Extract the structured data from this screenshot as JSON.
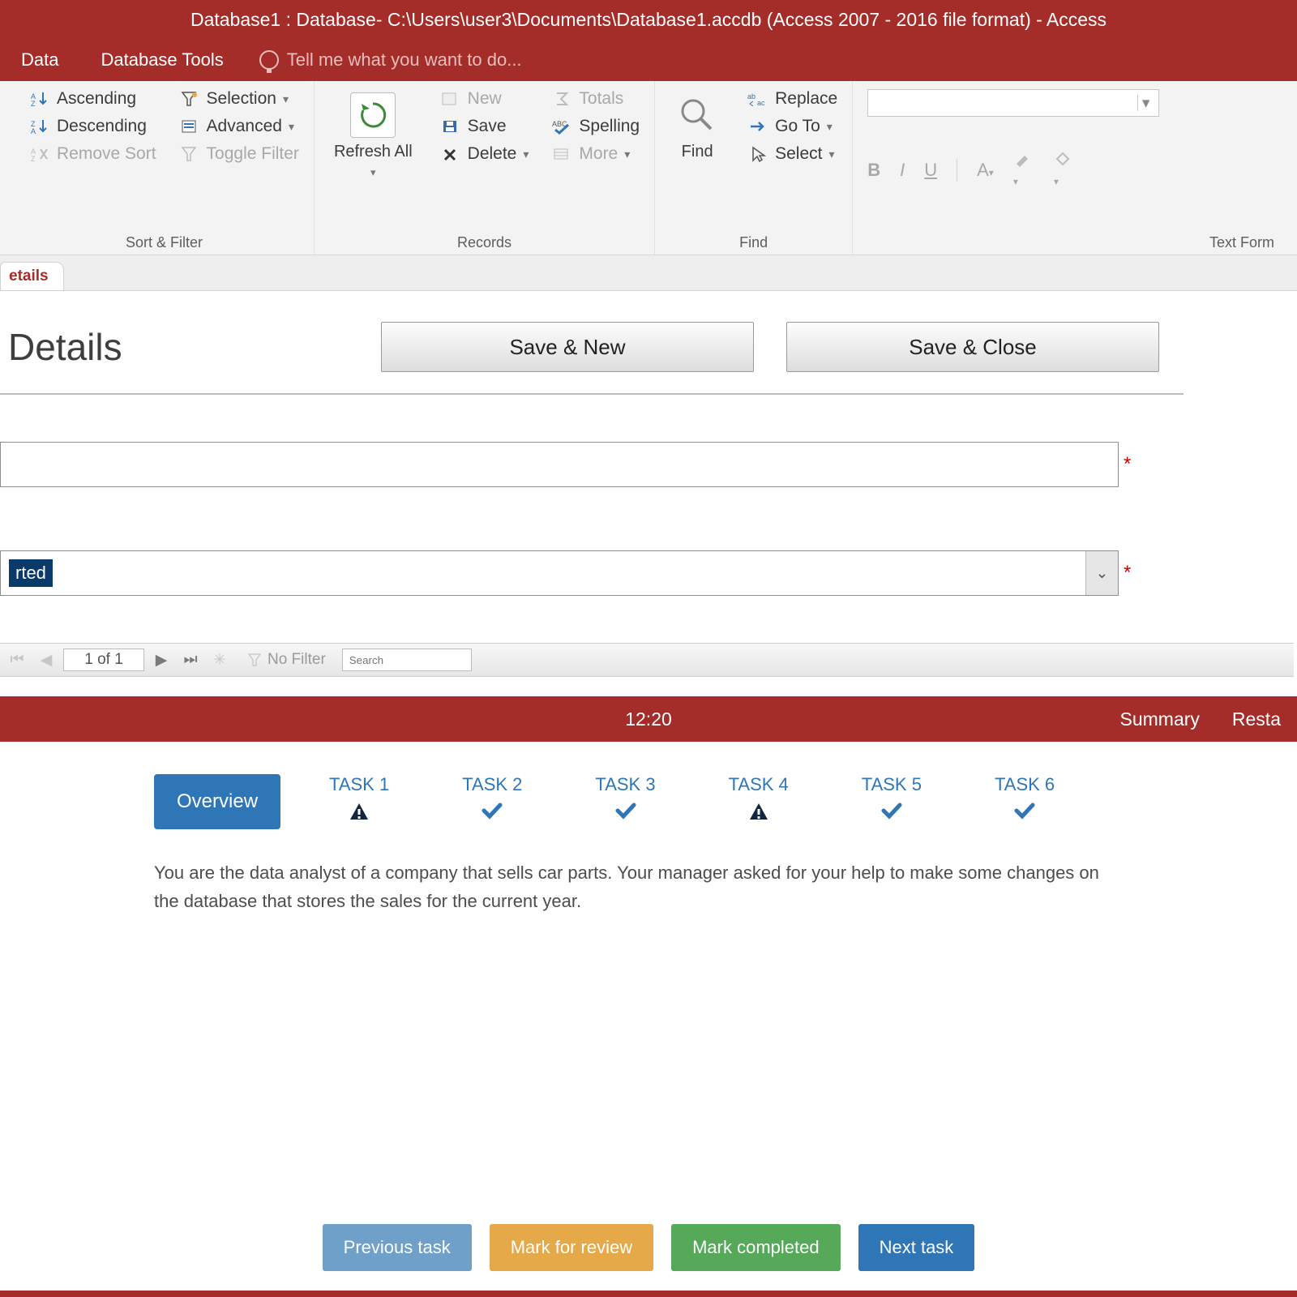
{
  "titlebar": "Database1 : Database- C:\\Users\\user3\\Documents\\Database1.accdb (Access 2007 - 2016 file format) - Access",
  "tabs": {
    "data": "Data",
    "dbtools": "Database Tools",
    "tellme": "Tell me what you want to do..."
  },
  "ribbon": {
    "sortfilter": {
      "label": "Sort & Filter",
      "asc": "Ascending",
      "desc": "Descending",
      "remove": "Remove Sort",
      "selection": "Selection",
      "advanced": "Advanced",
      "toggle": "Toggle Filter"
    },
    "records": {
      "label": "Records",
      "refresh": "Refresh All",
      "new": "New",
      "save": "Save",
      "delete": "Delete",
      "totals": "Totals",
      "spelling": "Spelling",
      "more": "More"
    },
    "find_group": {
      "label": "Find",
      "find": "Find",
      "replace": "Replace",
      "goto": "Go To",
      "select": "Select"
    },
    "textfmt": {
      "label": "Text Form"
    }
  },
  "doc_tab": "etails",
  "form": {
    "title": "Details",
    "save_new": "Save & New",
    "save_close": "Save & Close",
    "combo_value": "rted"
  },
  "recnav": {
    "position": "1 of 1",
    "no_filter": "No Filter",
    "search_placeholder": "Search"
  },
  "taskbar": {
    "time": "12:20",
    "summary": "Summary",
    "restart": "Resta"
  },
  "tasks": {
    "overview": "Overview",
    "items": [
      {
        "label": "TASK 1",
        "status": "warn"
      },
      {
        "label": "TASK 2",
        "status": "check"
      },
      {
        "label": "TASK 3",
        "status": "check"
      },
      {
        "label": "TASK 4",
        "status": "warn"
      },
      {
        "label": "TASK 5",
        "status": "check"
      },
      {
        "label": "TASK 6",
        "status": "check"
      }
    ],
    "description": "You are the data analyst of a company that sells car parts. Your manager asked for your help to make some changes on the database that stores the sales for the current year."
  },
  "footer": {
    "prev": "Previous task",
    "review": "Mark for review",
    "done": "Mark completed",
    "next": "Next task"
  }
}
